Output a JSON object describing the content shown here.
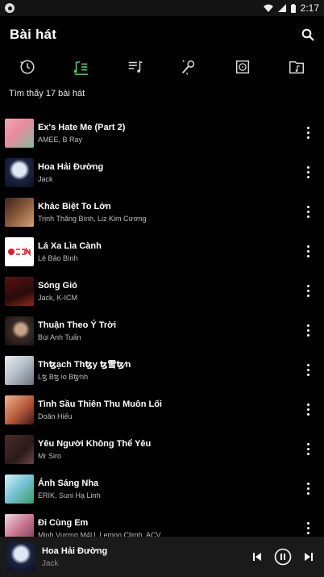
{
  "status": {
    "time": "2:17"
  },
  "header": {
    "title": "Bài hát"
  },
  "tabs": [
    {
      "id": "recent",
      "icon": "clock-icon"
    },
    {
      "id": "songs",
      "icon": "music-list-icon",
      "active": true
    },
    {
      "id": "playlists",
      "icon": "playlist-icon"
    },
    {
      "id": "artists",
      "icon": "microphone-icon"
    },
    {
      "id": "albums",
      "icon": "album-icon"
    },
    {
      "id": "folders",
      "icon": "folder-music-icon"
    }
  ],
  "colors": {
    "accent": "#4cd964",
    "background": "#000000",
    "secondary_text": "#bfbfbf"
  },
  "count_label": "Tìm thấy 17 bài hát",
  "songs": [
    {
      "title": "Ex's Hate Me (Part 2)",
      "artist": "AMEE, B Ray"
    },
    {
      "title": "Hoa Hải Đường",
      "artist": "Jack"
    },
    {
      "title": "Khác Biệt To Lớn",
      "artist": "Trịnh Thăng Bình, Liz Kim Cương"
    },
    {
      "title": "Lá Xa Lìa Cành",
      "artist": "Lê Bảo Bình"
    },
    {
      "title": "Sóng Gió",
      "artist": "Jack, K-ICM"
    },
    {
      "title": "Thuận Theo Ý Trời",
      "artist": "Bùi Anh Tuấn"
    },
    {
      "title": "Thꜩạch Thꜩy ꜩ雪ꜩ⁄n",
      "artist": "Lꜩ Bꜩ꜋o Bꜩ⁄nh"
    },
    {
      "title": "Tình Sầu Thiên Thu Muôn Lối",
      "artist": "Doãn Hiếu"
    },
    {
      "title": "Yêu Người Không Thể Yêu",
      "artist": "Mr Siro"
    },
    {
      "title": "Ánh Sáng Nha",
      "artist": "ERIK, Suni Hạ Linh"
    },
    {
      "title": "Đi Cùng Em",
      "artist": "Minh Vương M4U, Lemon Climb, ACV"
    }
  ],
  "now_playing": {
    "title": "Hoa Hải Đường",
    "artist": "Jack"
  }
}
